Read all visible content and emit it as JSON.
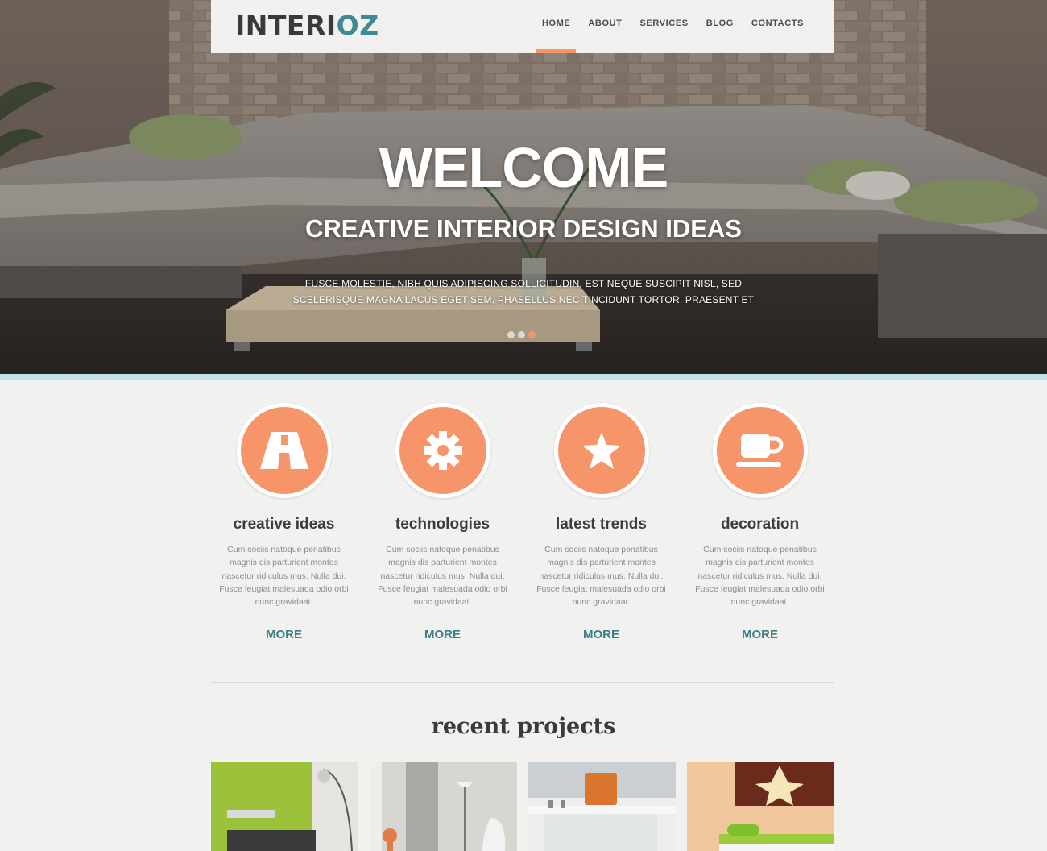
{
  "logo": {
    "main": "INTERI",
    "accent": "OZ"
  },
  "nav": [
    {
      "label": "HOME",
      "active": true
    },
    {
      "label": "ABOUT",
      "active": false
    },
    {
      "label": "SERVICES",
      "active": false
    },
    {
      "label": "BLOG",
      "active": false
    },
    {
      "label": "CONTACTS",
      "active": false
    }
  ],
  "hero": {
    "title": "WELCOME",
    "subtitle": "CREATIVE INTERIOR DESIGN IDEAS",
    "text": "FUSCE MOLESTIE, NIBH QUIS ADIPISCING SOLLICITUDIN, EST NEQUE SUSCIPIT NISL, SED SCELERISQUE MAGNA LACUS EGET SEM. PHASELLUS NEC TINCIDUNT TORTOR. PRAESENT ET",
    "slides": 3,
    "active_slide": 3
  },
  "features": [
    {
      "icon": "road-icon",
      "title": "creative ideas",
      "text": "Cum sociis natoque penatibus magnis dis parturient montes nascetur ridiculus mus. Nulla dui. Fusce feugiat malesuada odio orbi nunc gravidaat.",
      "more": "MORE"
    },
    {
      "icon": "gear-icon",
      "title": "technologies",
      "text": "Cum sociis natoque penatibus magnis dis parturient montes nascetur ridiculus mus. Nulla dui. Fusce feugiat malesuada odio orbi nunc gravidaat.",
      "more": "MORE"
    },
    {
      "icon": "star-icon",
      "title": "latest trends",
      "text": "Cum sociis natoque penatibus magnis dis parturient montes nascetur ridiculus mus. Nulla dui. Fusce feugiat malesuada odio orbi nunc gravidaat.",
      "more": "MORE"
    },
    {
      "icon": "cup-icon",
      "title": "decoration",
      "text": "Cum sociis natoque penatibus magnis dis parturient montes nascetur ridiculus mus. Nulla dui. Fusce feugiat malesuada odio orbi nunc gravidaat.",
      "more": "MORE"
    }
  ],
  "recent": {
    "title": "recent projects"
  },
  "colors": {
    "accent": "#f7956a",
    "teal": "#3d8a93",
    "stripe": "#bfe2e7"
  }
}
